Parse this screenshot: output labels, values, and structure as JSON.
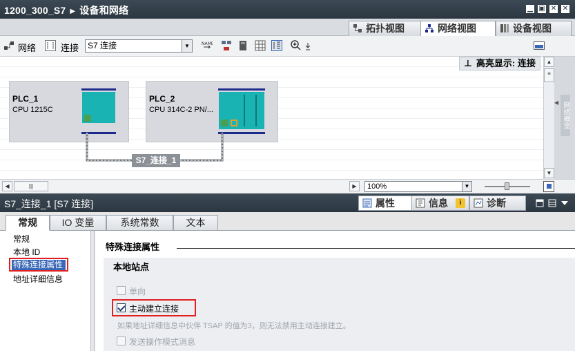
{
  "window": {
    "project": "1200_300_S7",
    "section": "设备和网络",
    "minimize": "▁",
    "restore": "▣",
    "close": "✕"
  },
  "view_tabs": [
    {
      "label": "拓扑视图",
      "icon": "topology-view-icon",
      "active": false
    },
    {
      "label": "网络视图",
      "icon": "network-view-icon",
      "active": true
    },
    {
      "label": "设备视图",
      "icon": "device-view-icon",
      "active": false
    }
  ],
  "toolbar": {
    "network_label": "网络",
    "connection_label": "连接",
    "connection_type": "S7 连接"
  },
  "canvas": {
    "highlight_label": "高亮显示: 连接",
    "connection_label": "S7_连接_1",
    "devices": [
      {
        "name": "PLC_1",
        "type": "CPU 1215C"
      },
      {
        "name": "PLC_2",
        "type": "CPU 314C-2 PN/..."
      }
    ],
    "side_panel_label": "网络概览",
    "zoom": "100%"
  },
  "inspector": {
    "title": "S7_连接_1 [S7 连接]",
    "tabs": [
      {
        "label": "属性",
        "active": true
      },
      {
        "label": "信息",
        "active": false
      },
      {
        "label": "诊断",
        "active": false
      }
    ]
  },
  "property_tabs": [
    {
      "label": "常规",
      "active": true
    },
    {
      "label": "IO 变量",
      "active": false
    },
    {
      "label": "系统常数",
      "active": false
    },
    {
      "label": "文本",
      "active": false
    }
  ],
  "nav_items": [
    "常规",
    "本地 ID",
    "特殊连接属性",
    "地址详细信息"
  ],
  "nav_selected_index": 2,
  "content": {
    "section_title": "特殊连接属性",
    "subsection_title": "本地站点",
    "options": [
      {
        "label": "单向",
        "checked": false,
        "enabled": false
      },
      {
        "label": "主动建立连接",
        "checked": true,
        "enabled": true
      },
      {
        "label": "发送操作模式消息",
        "checked": false,
        "enabled": false
      }
    ],
    "note": "如果地址详细信息中伙伴 TSAP 的值为3，则无法禁用主动连接建立。"
  },
  "colors": {
    "titlebar": "#2b3640",
    "highlight_red": "#e02020",
    "selection_blue": "#3a68b8",
    "module_teal": "#1ab3b3"
  }
}
